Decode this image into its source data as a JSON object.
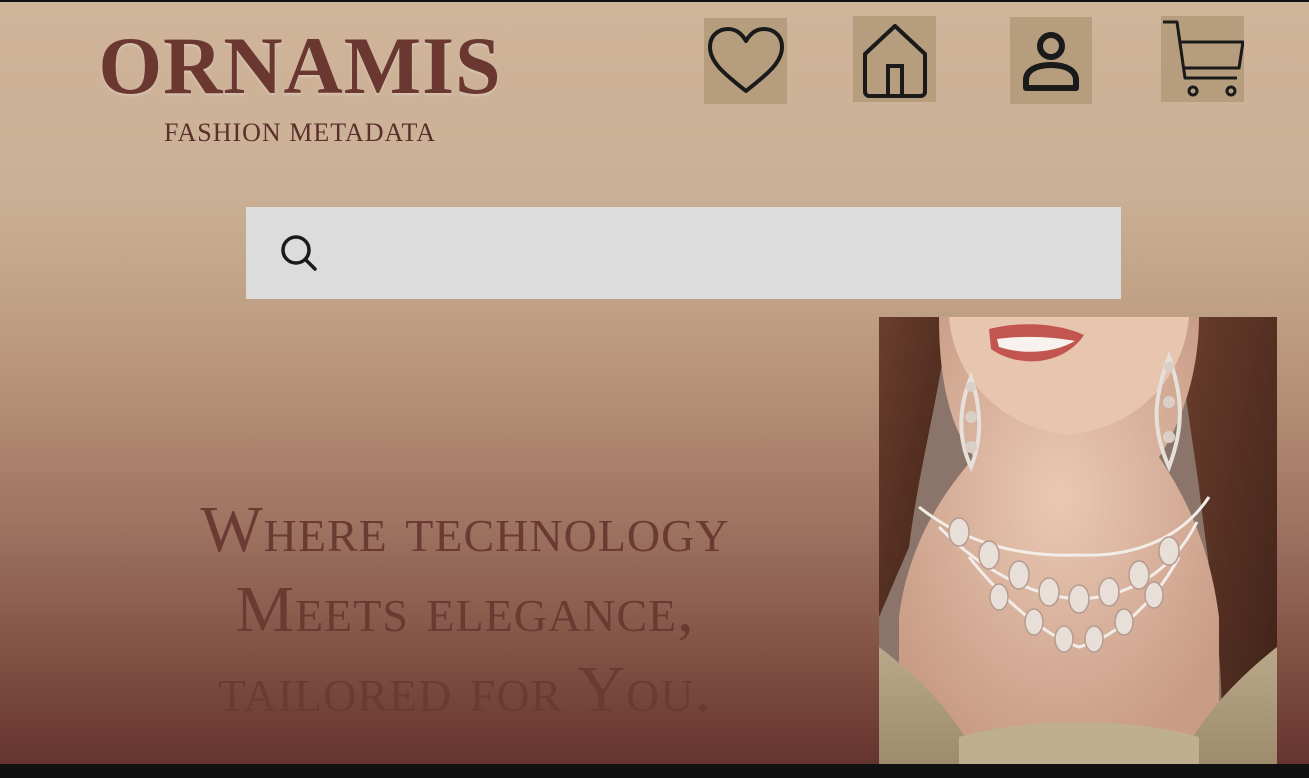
{
  "brand": {
    "logo_text": "ORNAMIS",
    "subtitle": "FASHION METADATA",
    "color": "#6a3830"
  },
  "nav": {
    "wishlist_icon": "heart-icon",
    "home_icon": "home-icon",
    "account_icon": "user-icon",
    "cart_icon": "cart-icon",
    "button_color": "#b59d7e"
  },
  "search": {
    "icon": "search-icon",
    "placeholder": "",
    "value": ""
  },
  "hero": {
    "headline_line1": "Where technology",
    "headline_line2": "Meets elegance,",
    "headline_line3": "tailored for You.",
    "image": "model-with-diamond-necklace-and-earrings"
  },
  "colors": {
    "background_top": "#cfb49a",
    "background_bottom": "#663430",
    "search_bg": "#dcdcdc"
  }
}
